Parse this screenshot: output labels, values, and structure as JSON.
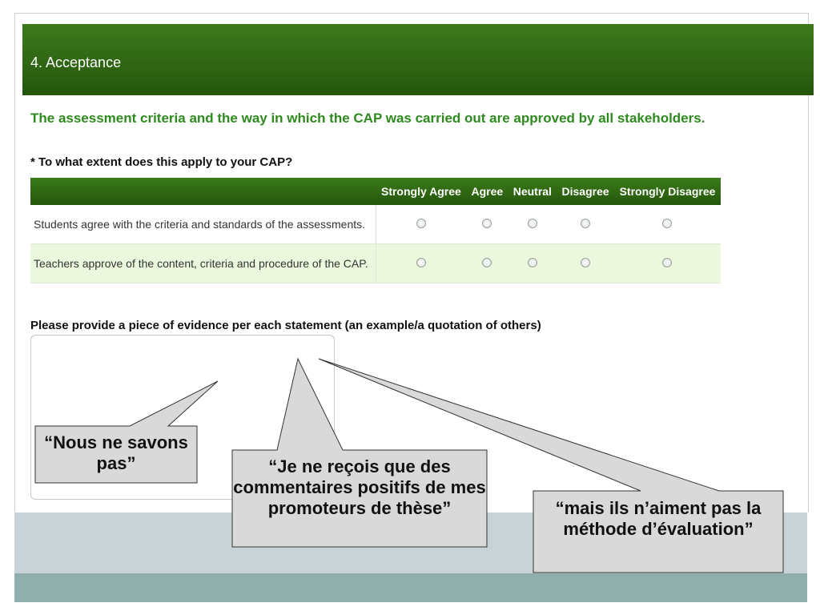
{
  "section": {
    "title": "4. Acceptance"
  },
  "statement": "The assessment criteria and the way in which the CAP was carried out are approved by all stakeholders.",
  "question": "* To what extent does this apply to your CAP?",
  "matrix": {
    "columns": [
      "Strongly Agree",
      "Agree",
      "Neutral",
      "Disagree",
      "Strongly Disagree"
    ],
    "rows": [
      {
        "label": "Students agree with the criteria and standards of the assessments.",
        "selected": null
      },
      {
        "label": "Teachers approve of the content, criteria and procedure of the CAP.",
        "selected": null
      }
    ]
  },
  "evidence": {
    "label": "Please provide a piece of evidence per each statement (an example/a quotation of others)",
    "value": ""
  },
  "callouts": [
    {
      "text": "“Nous ne savons pas”"
    },
    {
      "text": "“Je ne reçois que des commentaires positifs de mes promoteurs de thèse”"
    },
    {
      "text": "“mais ils n’aiment pas la méthode d’évaluation”"
    }
  ],
  "colors": {
    "header_green": "#2f6a15",
    "statement_green": "#2e8a1e",
    "row_alt": "#ecf8dd",
    "callout_fill": "#d9d9d9",
    "band_top": "#c8d3d8",
    "band_bottom": "#8faeac"
  }
}
